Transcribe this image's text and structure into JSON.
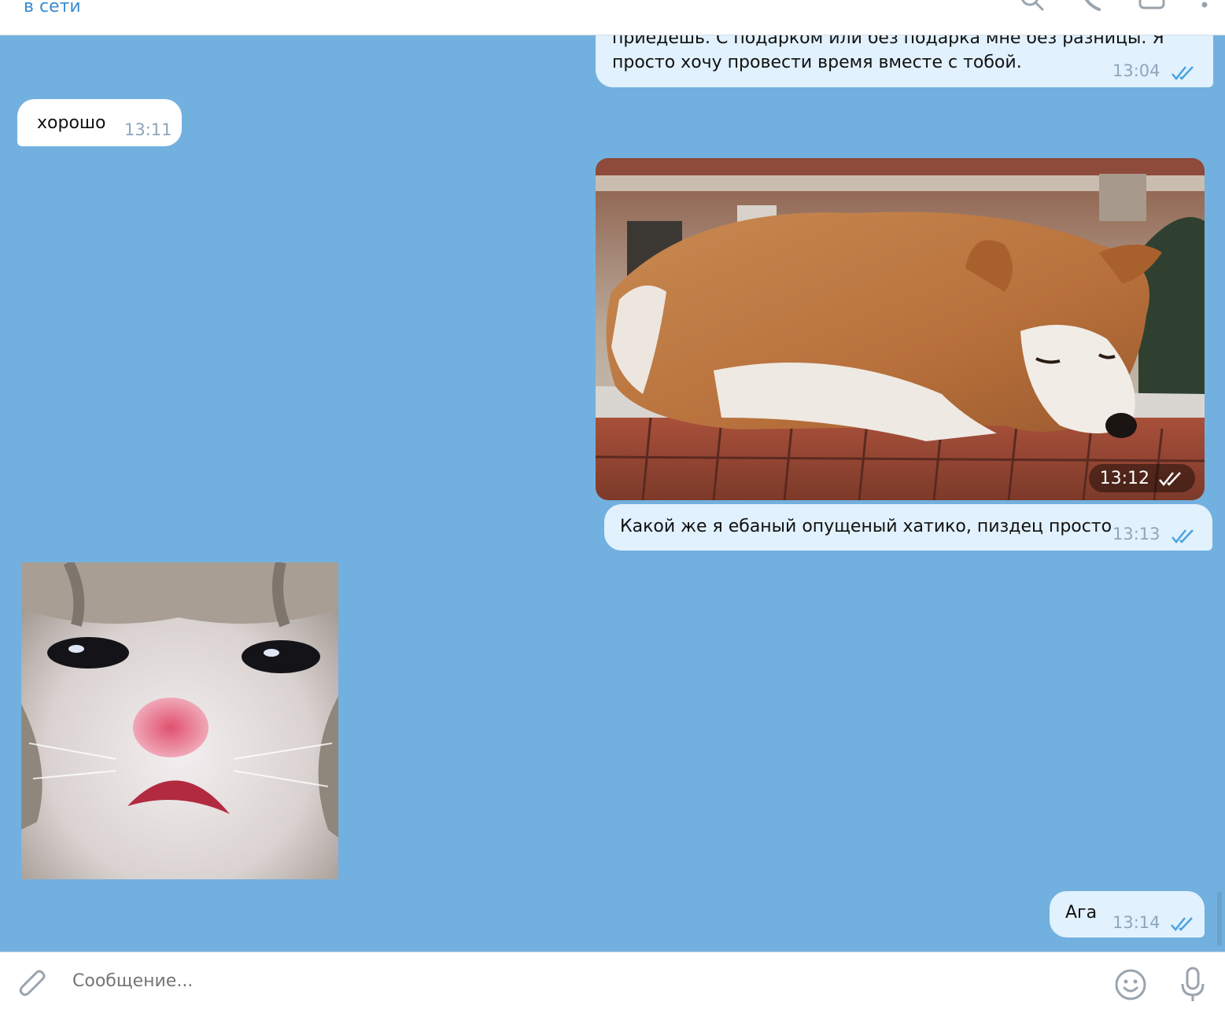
{
  "header": {
    "status": "в сети",
    "icons": [
      "search-icon",
      "phone-icon",
      "sidebar-icon",
      "more-icon"
    ]
  },
  "messages": [
    {
      "side": "out",
      "text_line1": "приедешь. С подарком или без подарка мне без разницы. Я",
      "text_line2": "просто хочу провести время вместе с тобой.",
      "time": "13:04"
    },
    {
      "side": "in",
      "text": "хорошо",
      "time": "13:11"
    },
    {
      "side": "out",
      "type": "photo",
      "subject": "dog",
      "time": "13:12"
    },
    {
      "side": "out",
      "text": "Какой же я ебаный опущеный хатико, пиздец просто",
      "time": "13:13"
    },
    {
      "side": "in",
      "type": "sticker",
      "subject": "kitten"
    },
    {
      "side": "out",
      "text": "Ага",
      "time": "13:14"
    }
  ],
  "composer": {
    "placeholder": "Сообщение...",
    "icons": [
      "attach-icon",
      "emoji-icon",
      "microphone-icon"
    ]
  },
  "colors": {
    "chat_background": "#72b0df",
    "outgoing_bubble": "#e1f1fd",
    "incoming_bubble": "#ffffff",
    "accent": "#3a8bd0",
    "read_ticks": "#4aa3e0"
  }
}
